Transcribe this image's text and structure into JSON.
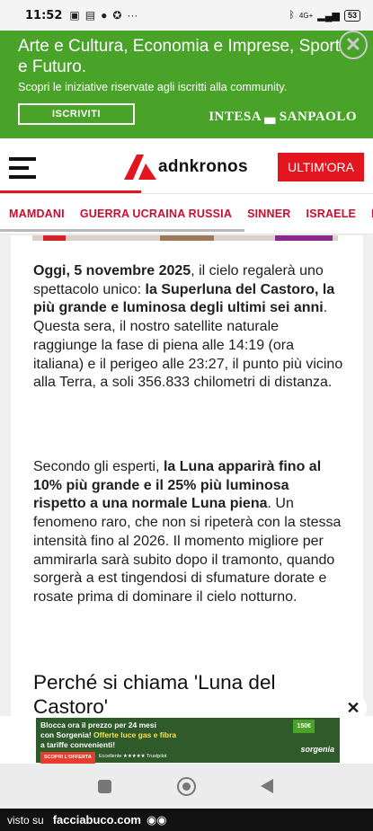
{
  "status_bar": {
    "time": "11:52",
    "left_icons": [
      "nfc-icon",
      "sim-icon",
      "chat-icon",
      "mute-icon",
      "more-icon"
    ],
    "network": "4G+",
    "battery": "53"
  },
  "ad_top": {
    "headline": "Arte e Cultura, Economia e Imprese, Sport e Futuro.",
    "subtext": "Scopri le iniziative riservate agli iscritti alla community.",
    "cta": "ISCRIVITI",
    "brand": "INTESA ▃ SANPAOLO",
    "bg_color": "#4aa329"
  },
  "header": {
    "logo_text": "adnkronos",
    "button_label": "ULTIM'ORA",
    "accent_color": "#e3161f"
  },
  "tags": [
    "MAMDANI",
    "GUERRA UCRAINA RUSSIA",
    "SINNER",
    "ISRAELE",
    "MA"
  ],
  "article": {
    "p1": {
      "date": "Oggi, 5 novembre 2025",
      "t1": ", il cielo regalerà uno spettacolo unico: ",
      "b1": "la Superluna del Castoro, la più grande e luminosa degli ultimi sei anni",
      "t2": ". Questa sera, il nostro satellite naturale raggiunge la fase di piena alle 14:19 (ora italiana) e il perigeo alle 23:27, il punto più vicino alla Terra, a soli 356.833 chilometri di distanza."
    },
    "p2": {
      "t1": "Secondo gli esperti, ",
      "b1": "la Luna apparirà fino al 10% più grande e il 25% più luminosa rispetto a una normale Luna piena",
      "t2": ". Un fenomeno raro, che non si ripeterà con la stessa intensità fino al 2026. Il momento migliore per ammirarla sarà subito dopo il tramonto, quando sorgerà a est tingendosi di sfumature dorate e rosate prima di dominare il cielo notturno."
    },
    "heading": "Perché si chiama 'Luna del Castoro'"
  },
  "ad_bottom": {
    "line1": "Blocca ora il prezzo per 24 mesi",
    "line2a": "con Sorgenia! ",
    "line2b": "Offerte luce gas e fibra",
    "line3": "a tariffe convenienti!",
    "button": "SCOPRI L'OFFERTA",
    "rating": "Eccellente ★★★★★ Trustpilot",
    "price": "150€",
    "brand": "sorgenia",
    "close": "✕"
  },
  "footer": {
    "prefix": "visto su",
    "site": "facciabuco.com",
    "eyes": "◉◉"
  }
}
